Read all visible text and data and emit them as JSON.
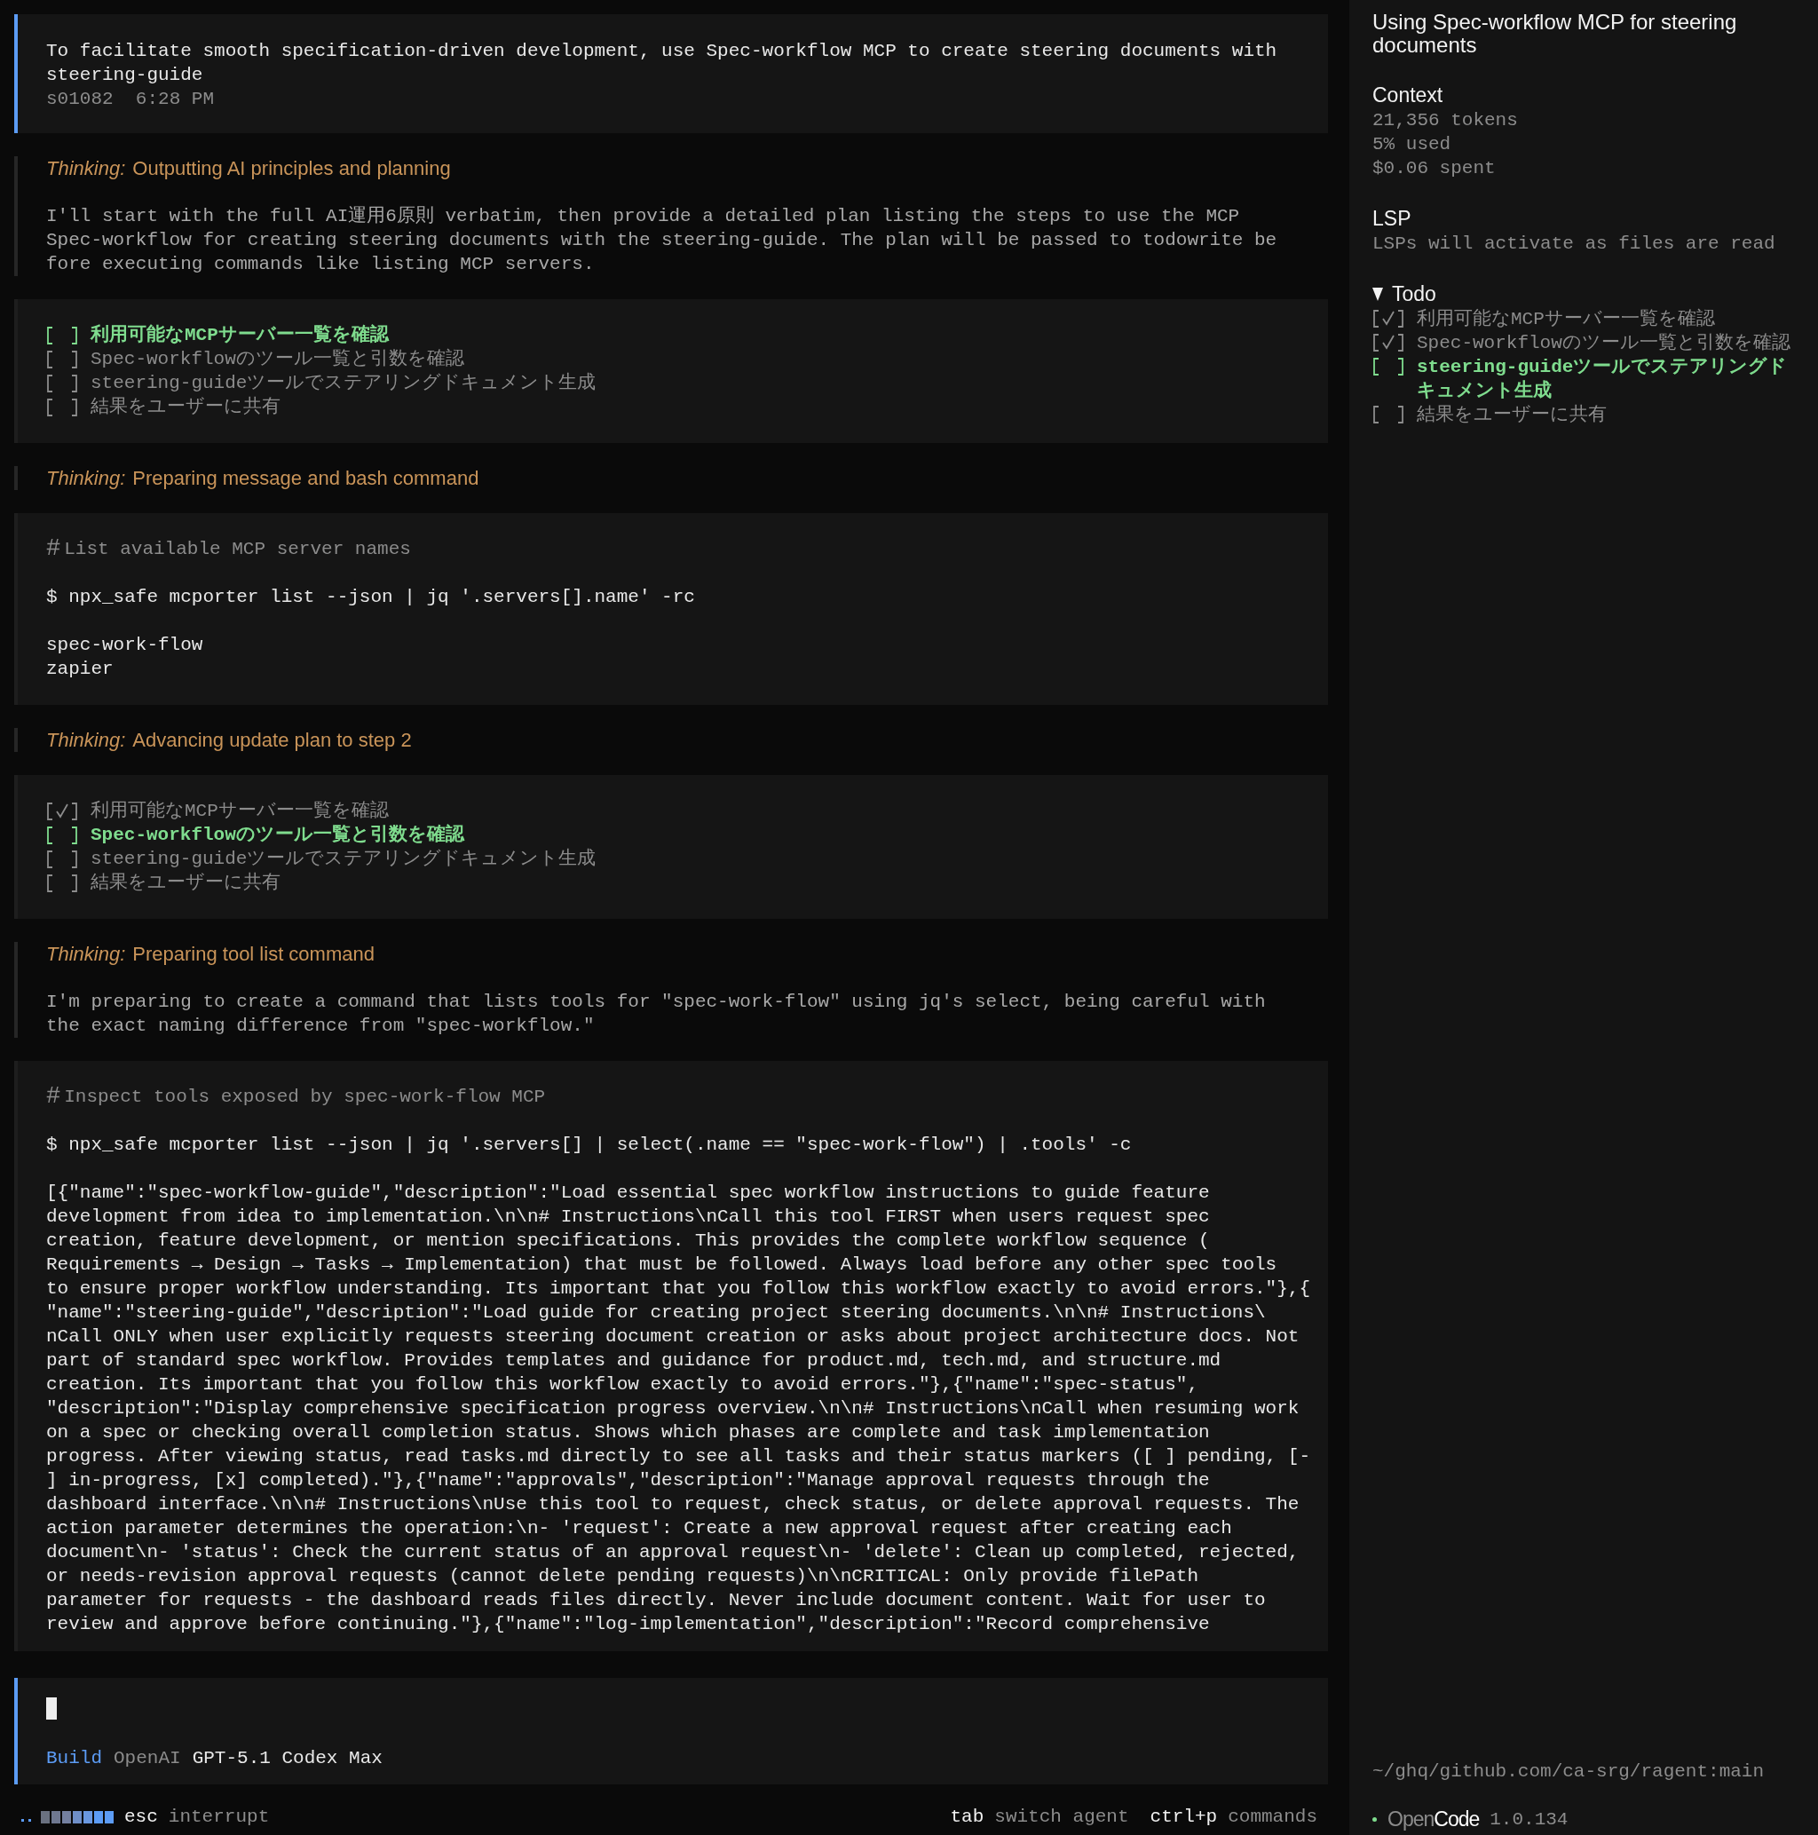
{
  "session": {
    "user_message": {
      "lines": [
        "To facilitate smooth specification-driven development, use Spec-workflow MCP to create steering documents with",
        "steering-guide"
      ],
      "user": "s01082",
      "time": "6:28 PM"
    },
    "entries": [
      {
        "kind": "thinking",
        "label": "Thinking:",
        "title": "Outputting AI principles and planning",
        "lines": [
          "I'll start with the full AI運用6原則 verbatim, then provide a detailed plan listing the steps to use the MCP",
          "Spec-workflow for creating steering documents with the steering-guide. The plan will be passed to todowrite be",
          "fore executing commands like listing MCP servers."
        ]
      },
      {
        "kind": "todo",
        "items": [
          {
            "text": "利用可能なMCPサーバー一覧を確認",
            "checked": false,
            "active": true
          },
          {
            "text": "Spec-workflowのツール一覧と引数を確認",
            "checked": false,
            "active": false
          },
          {
            "text": "steering-guideツールでステアリングドキュメント生成",
            "checked": false,
            "active": false
          },
          {
            "text": "結果をユーザーに共有",
            "checked": false,
            "active": false
          }
        ]
      },
      {
        "kind": "thinking",
        "label": "Thinking:",
        "title": "Preparing message and bash command"
      },
      {
        "kind": "bash",
        "prefix": "#",
        "description": "List available MCP server names",
        "command": "$ npx_safe mcporter list --json | jq '.servers[].name' -rc",
        "output": [
          "spec-work-flow",
          "zapier"
        ]
      },
      {
        "kind": "thinking",
        "label": "Thinking:",
        "title": "Advancing update plan to step 2"
      },
      {
        "kind": "todo",
        "items": [
          {
            "text": "利用可能なMCPサーバー一覧を確認",
            "checked": true,
            "active": false
          },
          {
            "text": "Spec-workflowのツール一覧と引数を確認",
            "checked": false,
            "active": true
          },
          {
            "text": "steering-guideツールでステアリングドキュメント生成",
            "checked": false,
            "active": false
          },
          {
            "text": "結果をユーザーに共有",
            "checked": false,
            "active": false
          }
        ]
      },
      {
        "kind": "thinking",
        "label": "Thinking:",
        "title": "Preparing tool list command",
        "lines": [
          "I'm preparing to create a command that lists tools for \"spec-work-flow\" using jq's select, being careful with",
          "the exact naming difference from \"spec-workflow.\""
        ]
      },
      {
        "kind": "bash",
        "prefix": "#",
        "description": "Inspect tools exposed by spec-work-flow MCP",
        "command": "$ npx_safe mcporter list --json | jq '.servers[] | select(.name == \"spec-work-flow\") | .tools' -c",
        "output": [
          "[{\"name\":\"spec-workflow-guide\",\"description\":\"Load essential spec workflow instructions to guide feature",
          "development from idea to implementation.\\n\\n# Instructions\\nCall this tool FIRST when users request spec",
          "creation, feature development, or mention specifications. This provides the complete workflow sequence (",
          "Requirements → Design → Tasks → Implementation) that must be followed. Always load before any other spec tools",
          "to ensure proper workflow understanding. Its important that you follow this workflow exactly to avoid errors.\"},{",
          "\"name\":\"steering-guide\",\"description\":\"Load guide for creating project steering documents.\\n\\n# Instructions\\",
          "nCall ONLY when user explicitly requests steering document creation or asks about project architecture docs. Not",
          "part of standard spec workflow. Provides templates and guidance for product.md, tech.md, and structure.md",
          "creation. Its important that you follow this workflow exactly to avoid errors.\"},{\"name\":\"spec-status\",",
          "\"description\":\"Display comprehensive specification progress overview.\\n\\n# Instructions\\nCall when resuming work",
          "on a spec or checking overall completion status. Shows which phases are complete and task implementation",
          "progress. After viewing status, read tasks.md directly to see all tasks and their status markers ([ ] pending, [-",
          "] in-progress, [x] completed).\"},{\"name\":\"approvals\",\"description\":\"Manage approval requests through the",
          "dashboard interface.\\n\\n# Instructions\\nUse this tool to request, check status, or delete approval requests. The",
          "action parameter determines the operation:\\n- 'request': Create a new approval request after creating each",
          "document\\n- 'status': Check the current status of an approval request\\n- 'delete': Clean up completed, rejected,",
          "or needs-revision approval requests (cannot delete pending requests)\\n\\nCRITICAL: Only provide filePath",
          "parameter for requests - the dashboard reads files directly. Never include document content. Wait for user to",
          "review and approve before continuing.\"},{\"name\":\"log-implementation\",\"description\":\"Record comprehensive"
        ]
      }
    ]
  },
  "prompt": {
    "mode": "Build",
    "provider": "OpenAI",
    "model": "GPT-5.1 Codex Max"
  },
  "status_bar": {
    "left": [
      {
        "key": "esc",
        "action": "interrupt"
      }
    ],
    "right": [
      {
        "key": "tab",
        "action": "switch agent"
      },
      {
        "key": "ctrl+p",
        "action": "commands"
      }
    ]
  },
  "sidebar": {
    "title": "Using Spec-workflow MCP for steering documents",
    "sections": [
      {
        "heading": "Context",
        "lines": [
          "21,356 tokens",
          "5% used",
          "$0.06 spent"
        ]
      },
      {
        "heading": "LSP",
        "lines": [
          "LSPs will activate as files are read"
        ]
      }
    ],
    "todo": {
      "heading": "Todo",
      "expanded": true,
      "items": [
        {
          "text": "利用可能なMCPサーバー一覧を確認",
          "checked": true,
          "active": false
        },
        {
          "text": "Spec-workflowのツール一覧と引数を確認",
          "checked": true,
          "active": false
        },
        {
          "text": "steering-guideツールでステアリングドキュメント生成",
          "checked": false,
          "active": true
        },
        {
          "text": "結果をユーザーに共有",
          "checked": false,
          "active": false
        }
      ]
    },
    "path": "~/ghq/github.com/ca-srg/ragent:main",
    "brand": {
      "first": "Open",
      "second": "Code"
    },
    "version": "1.0.134"
  }
}
